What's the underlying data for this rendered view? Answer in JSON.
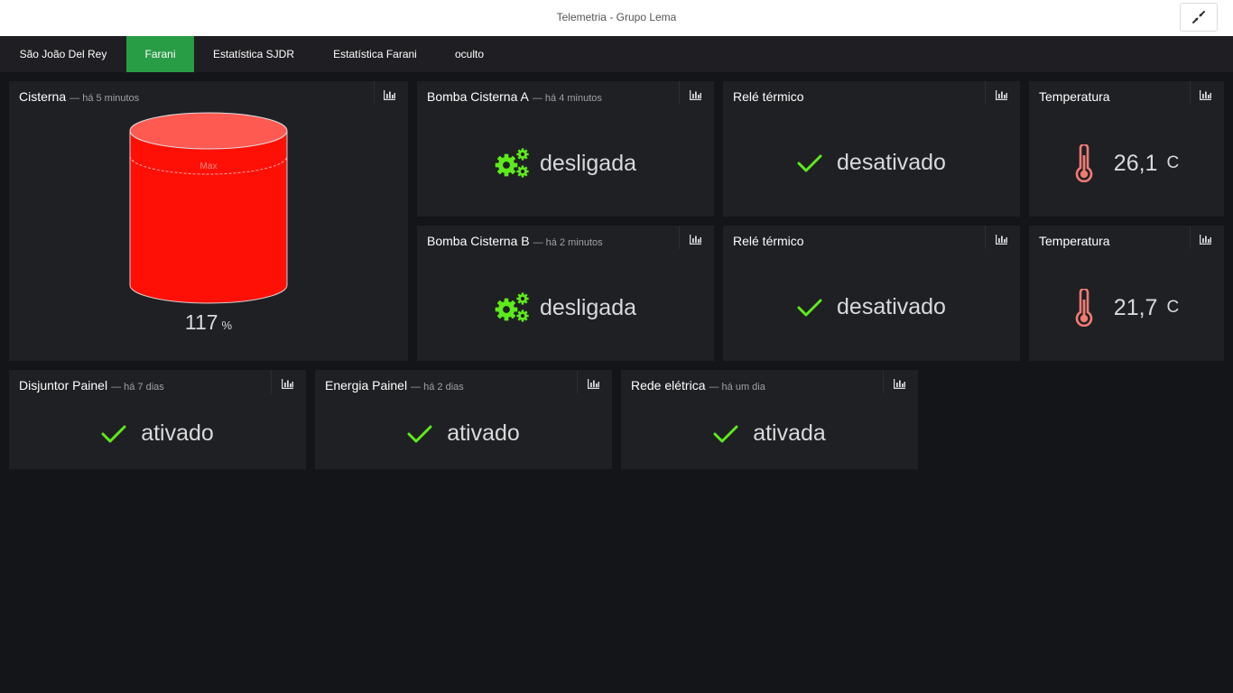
{
  "header": {
    "title": "Telemetria - Grupo Lema"
  },
  "nav": {
    "tabs": [
      {
        "label": "São João Del Rey",
        "active": false
      },
      {
        "label": "Farani",
        "active": true
      },
      {
        "label": "Estatística SJDR",
        "active": false
      },
      {
        "label": "Estatística Farani",
        "active": false
      },
      {
        "label": "oculto",
        "active": false
      }
    ]
  },
  "colors": {
    "ok": "#5eea1b",
    "danger": "#ff1007",
    "thermo": "#f07b73",
    "active_tab": "#299c46"
  },
  "panels": {
    "cisterna": {
      "title": "Cisterna",
      "ago": "— há 5 minutos",
      "max_label": "Max",
      "level": "117",
      "unit": "%"
    },
    "bomba_a": {
      "title": "Bomba Cisterna A",
      "ago": "— há 4 minutos",
      "status": "desligada",
      "icon": "gears-icon"
    },
    "rele_a": {
      "title": "Relé térmico",
      "status": "desativado",
      "icon": "check-icon"
    },
    "temp_a": {
      "title": "Temperatura",
      "value": "26,1",
      "unit": "C",
      "icon": "thermometer-icon"
    },
    "bomba_b": {
      "title": "Bomba Cisterna B",
      "ago": "— há 2 minutos",
      "status": "desligada",
      "icon": "gears-icon"
    },
    "rele_b": {
      "title": "Relé térmico",
      "status": "desativado",
      "icon": "check-icon"
    },
    "temp_b": {
      "title": "Temperatura",
      "value": "21,7",
      "unit": "C",
      "icon": "thermometer-icon"
    },
    "disjuntor": {
      "title": "Disjuntor Painel",
      "ago": "— há 7 dias",
      "status": "ativado",
      "icon": "check-icon"
    },
    "energia": {
      "title": "Energia Painel",
      "ago": "— há 2 dias",
      "status": "ativado",
      "icon": "check-icon"
    },
    "rede": {
      "title": "Rede elétrica",
      "ago": "— há um dia",
      "status": "ativada",
      "icon": "check-icon"
    }
  }
}
